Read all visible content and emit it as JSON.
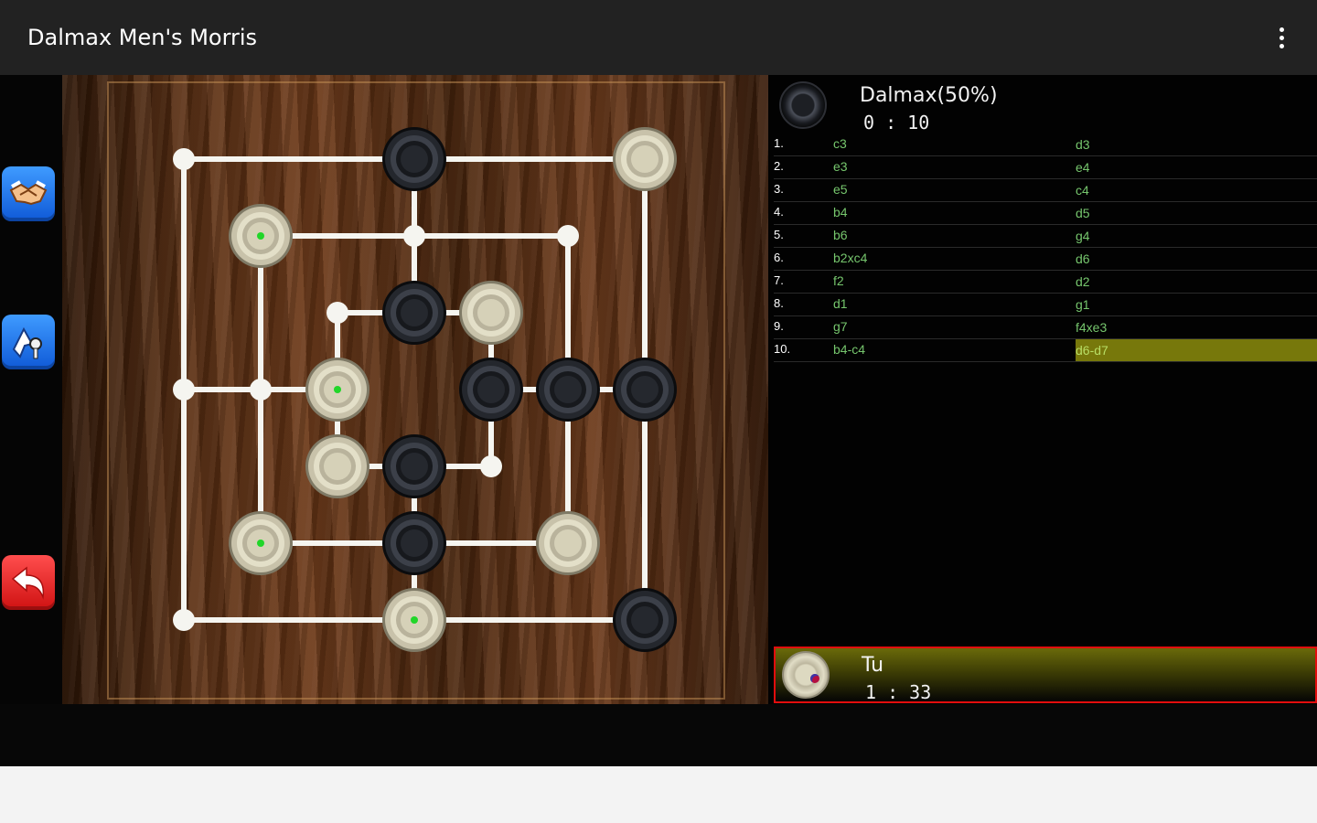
{
  "app": {
    "title": "Dalmax Men's Morris",
    "menu_icon": "more-vert-icon"
  },
  "sidebar": {
    "buttons": [
      {
        "name": "offer-draw",
        "icon": "handshake-icon",
        "color": "#1a72eb"
      },
      {
        "name": "hint",
        "icon": "pin-key-icon",
        "color": "#1a72eb"
      },
      {
        "name": "undo",
        "icon": "undo-arrow-icon",
        "color": "#e31b1b"
      }
    ]
  },
  "board": {
    "colors": {
      "lines": "#f5f5f0",
      "black_piece": "#1d1f24",
      "white_piece": "#d6d1b8",
      "marker": "#21d629"
    },
    "pieces": [
      {
        "square": "d7",
        "color": "black"
      },
      {
        "square": "g7",
        "color": "white"
      },
      {
        "square": "b6",
        "color": "white",
        "marked": true
      },
      {
        "square": "d5",
        "color": "black"
      },
      {
        "square": "e5",
        "color": "white"
      },
      {
        "square": "c4",
        "color": "white",
        "marked": true
      },
      {
        "square": "e4",
        "color": "black"
      },
      {
        "square": "f4",
        "color": "black"
      },
      {
        "square": "g4",
        "color": "black"
      },
      {
        "square": "c3",
        "color": "white"
      },
      {
        "square": "d3",
        "color": "black"
      },
      {
        "square": "b2",
        "color": "white",
        "marked": true
      },
      {
        "square": "d2",
        "color": "black"
      },
      {
        "square": "f2",
        "color": "white"
      },
      {
        "square": "d1",
        "color": "white",
        "marked": true
      },
      {
        "square": "g1",
        "color": "black"
      }
    ]
  },
  "opponent": {
    "name": "Dalmax(50%)",
    "time": "0 : 10",
    "piece": "black"
  },
  "moves": [
    {
      "num": "1.",
      "white": "c3",
      "black": "d3"
    },
    {
      "num": "2.",
      "white": "e3",
      "black": "e4"
    },
    {
      "num": "3.",
      "white": "e5",
      "black": "c4"
    },
    {
      "num": "4.",
      "white": "b4",
      "black": "d5"
    },
    {
      "num": "5.",
      "white": "b6",
      "black": "g4"
    },
    {
      "num": "6.",
      "white": "b2xc4",
      "black": "d6"
    },
    {
      "num": "7.",
      "white": "f2",
      "black": "d2"
    },
    {
      "num": "8.",
      "white": "d1",
      "black": "g1"
    },
    {
      "num": "9.",
      "white": "g7",
      "black": "f4xe3"
    },
    {
      "num": "10.",
      "white": "b4-c4",
      "black": "d6-d7",
      "highlight": true
    }
  ],
  "you": {
    "name": "Tu",
    "time": "1 : 33",
    "piece": "white",
    "active_border": "#e20d0d"
  }
}
